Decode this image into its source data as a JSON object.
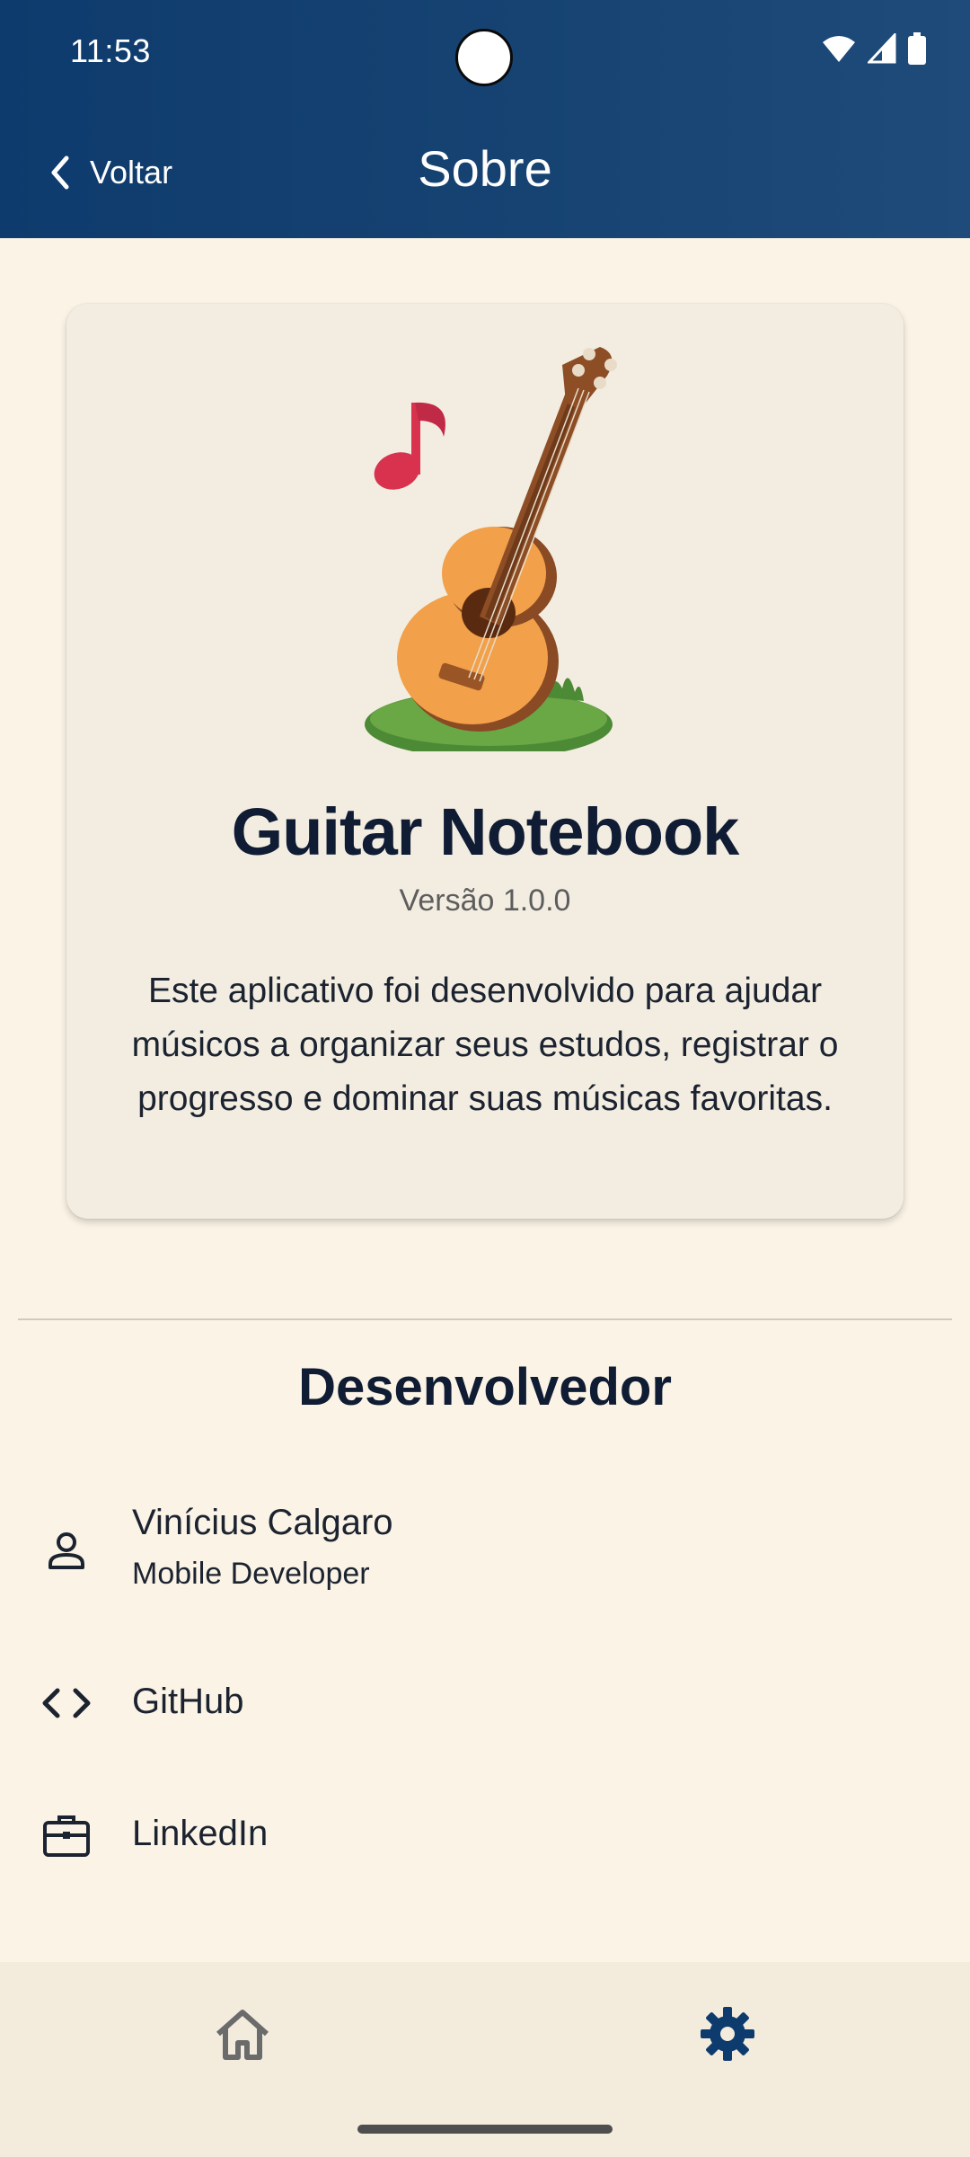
{
  "status_bar": {
    "time": "11:53"
  },
  "header": {
    "back_label": "Voltar",
    "title": "Sobre"
  },
  "about_card": {
    "app_name": "Guitar Notebook",
    "version": "Versão 1.0.0",
    "description": "Este aplicativo foi desenvolvido para ajudar músicos a organizar seus estudos, registrar o progresso e dominar suas músicas favoritas."
  },
  "developer": {
    "section_title": "Desenvolvedor",
    "name": "Vinícius Calgaro",
    "role": "Mobile Developer",
    "github_label": "GitHub",
    "linkedin_label": "LinkedIn"
  },
  "bottom_nav": {
    "items": [
      {
        "icon": "home-icon",
        "active": false
      },
      {
        "icon": "gear-icon",
        "active": true
      }
    ]
  },
  "colors": {
    "header_bg": "#0e3b6d",
    "page_bg": "#fbf4e6",
    "card_bg": "#f3ede1",
    "text_dark": "#0f1c33",
    "nav_active": "#0e3b6d",
    "nav_inactive": "#6b6b6b"
  }
}
